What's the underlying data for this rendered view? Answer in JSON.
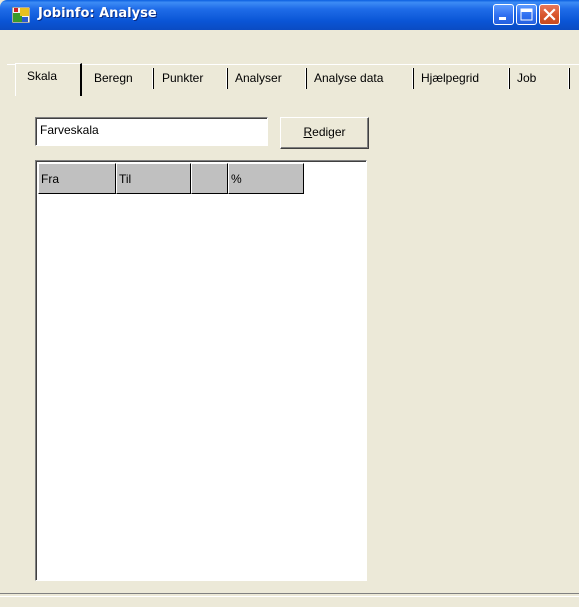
{
  "window": {
    "title": "Jobinfo: Analyse"
  },
  "tabs": [
    {
      "label": "Skala",
      "active": true
    },
    {
      "label": "Beregn"
    },
    {
      "label": "Punkter"
    },
    {
      "label": "Analyser"
    },
    {
      "label": "Analyse data"
    },
    {
      "label": "Hjælpegrid"
    },
    {
      "label": "Job"
    }
  ],
  "scale": {
    "name_value": "Farveskala",
    "edit_button_label_ul": "R",
    "edit_button_label_rest": "ediger"
  },
  "grid": {
    "columns": [
      "Fra",
      "Til",
      "",
      "%"
    ],
    "rows": []
  },
  "colors": {
    "titlebar": "#0a55d6",
    "close_button": "#d8552b",
    "window_bg": "#ece9d8",
    "grid_header": "#c0c0c0"
  },
  "icons": {
    "app": "app-icon",
    "minimize": "minimize-icon",
    "maximize": "maximize-icon",
    "close": "close-icon"
  }
}
